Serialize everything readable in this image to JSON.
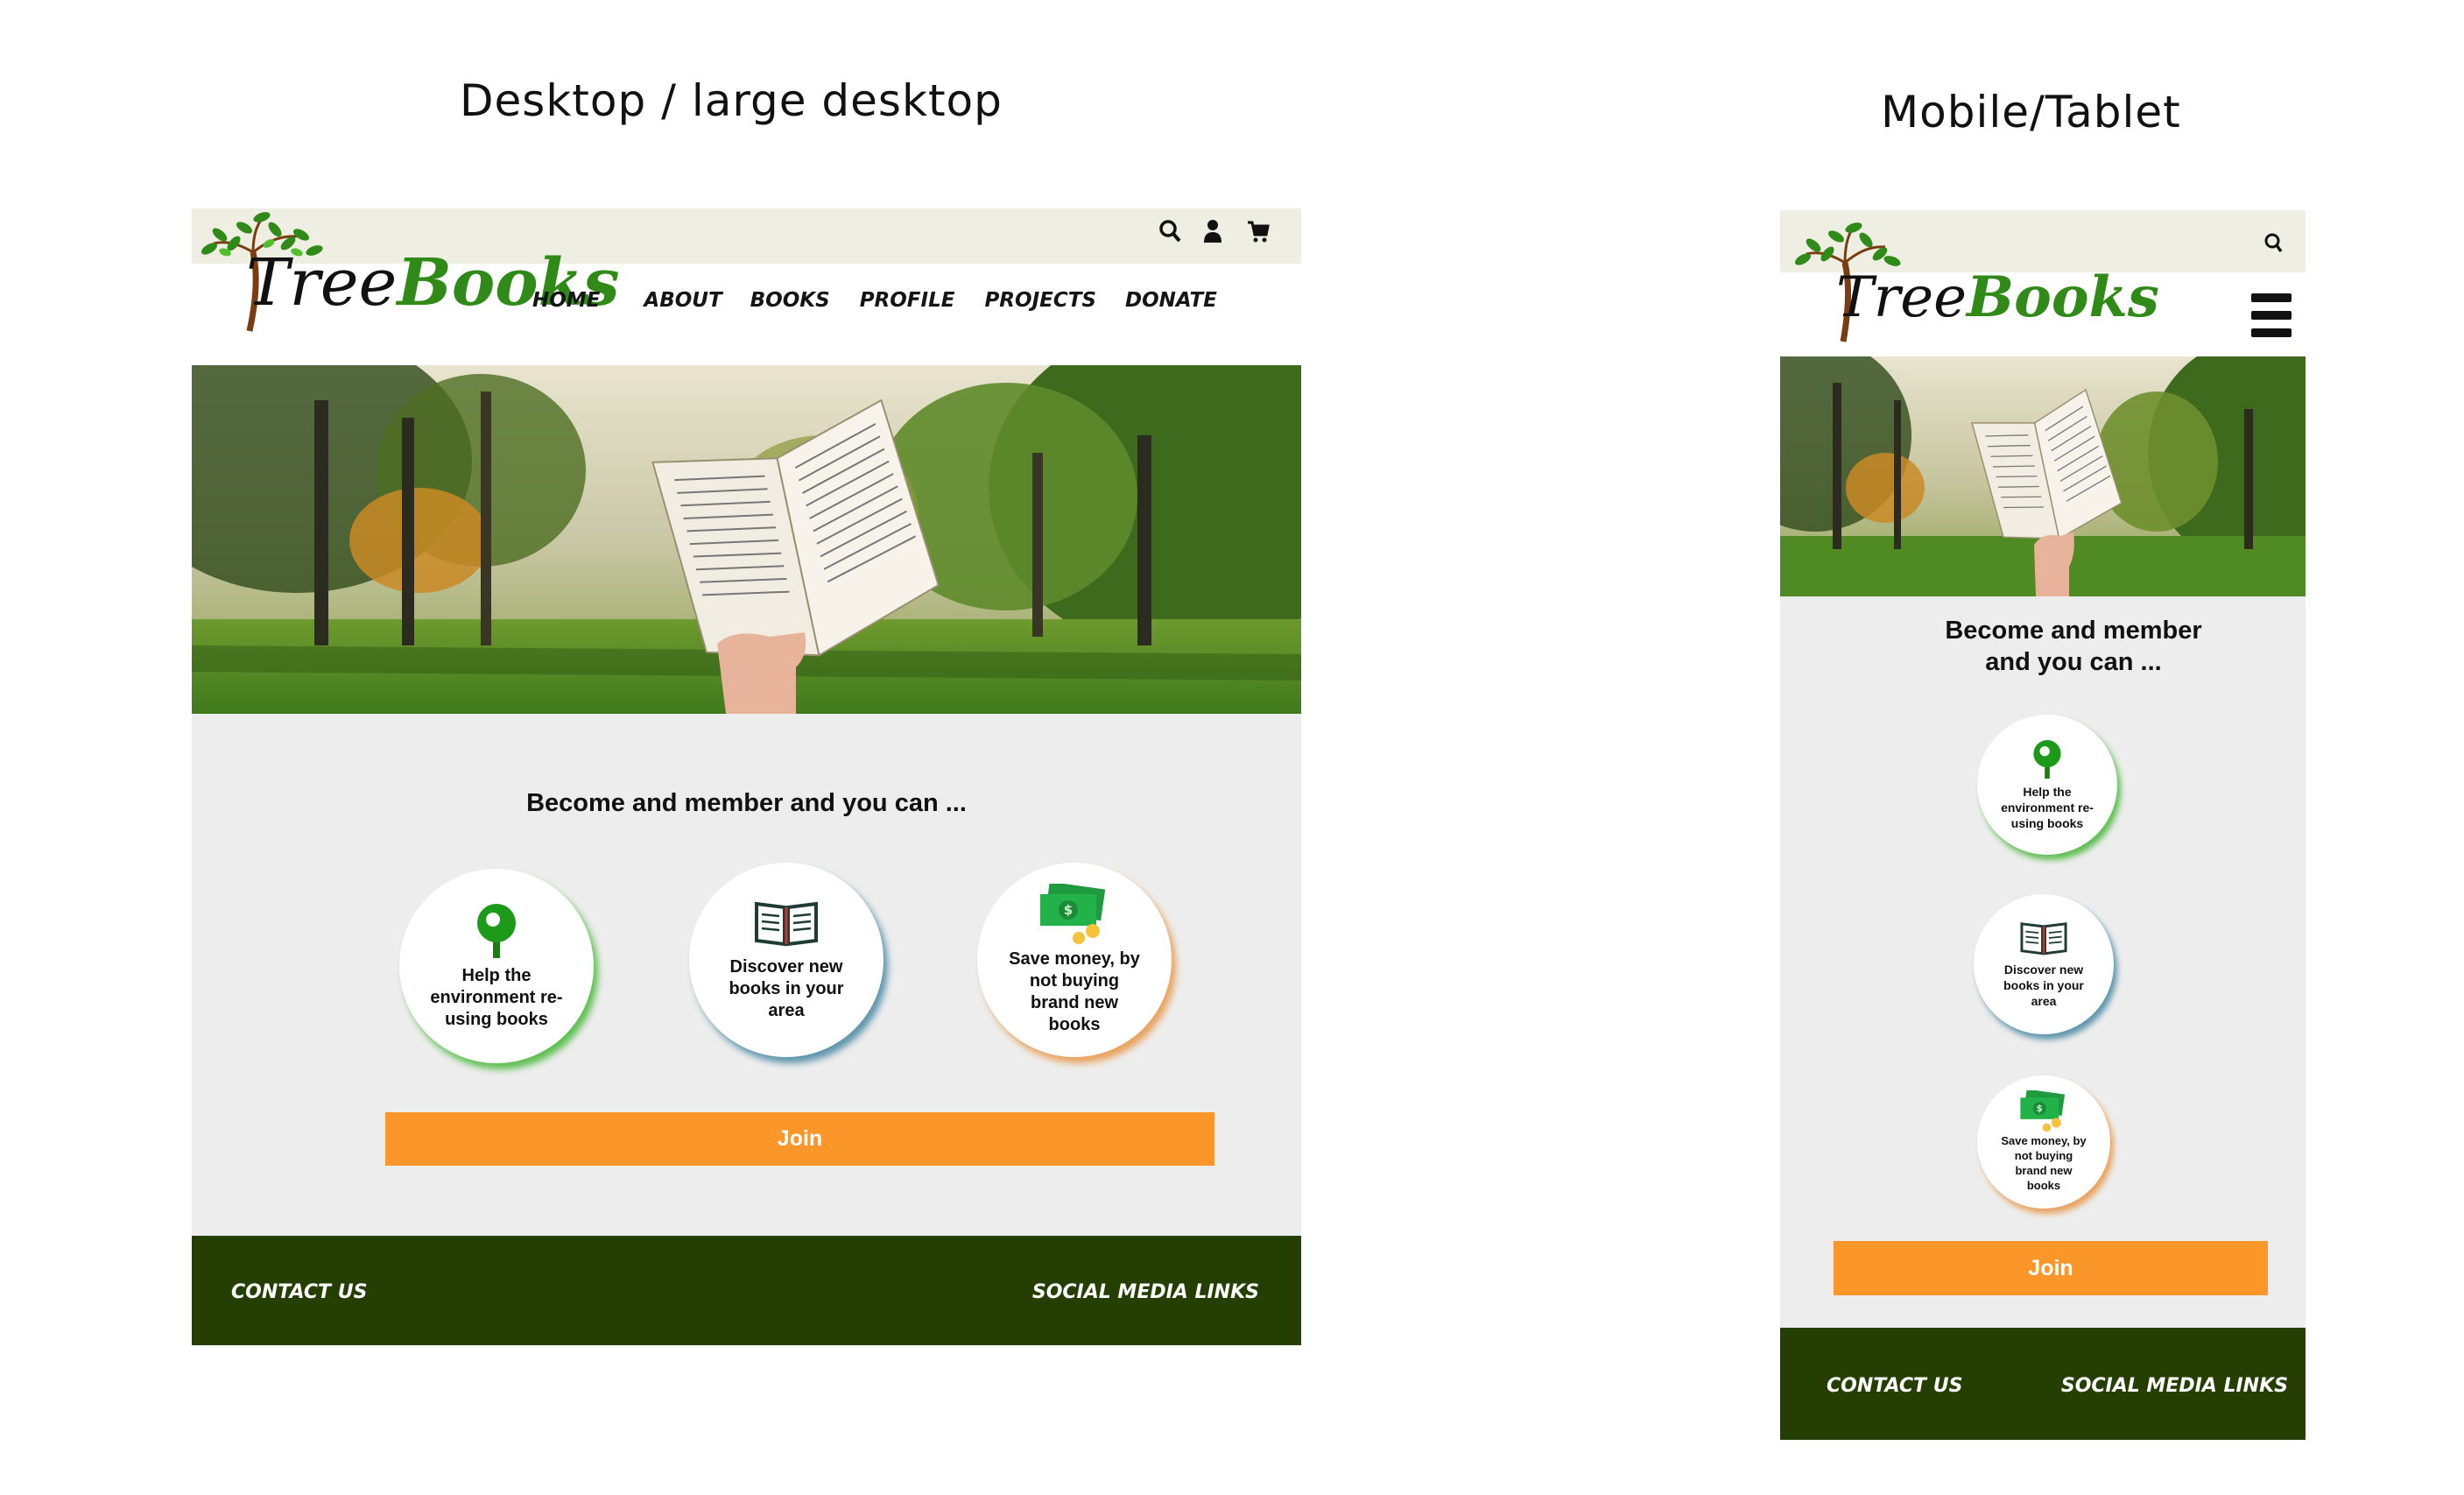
{
  "captions": {
    "desktop": "Desktop / large desktop",
    "mobile": "Mobile/Tablet"
  },
  "brand": {
    "name_first": "Tree",
    "name_second": "Books",
    "colors": {
      "topbar": "#eeeee2",
      "content_bg": "#ededed",
      "footer": "#243f01",
      "join_button": "#fb962a",
      "leaf_green": "#2f8a17"
    }
  },
  "icons": {
    "search": "search-icon",
    "account": "user-icon",
    "cart": "cart-icon",
    "menu": "hamburger-menu-icon",
    "environment": "tree-icon",
    "books": "open-book-icon",
    "money": "money-icon"
  },
  "desktop": {
    "nav": [
      "HOME",
      "ABOUT",
      "BOOKS",
      "PROFILE",
      "PROJECTS",
      "DONATE"
    ],
    "hero_alt": "Hand holding an open book in a forest",
    "headline": "Become and member and you can ...",
    "benefits": [
      {
        "text": "Help the environment re-using books",
        "icon": "tree-icon",
        "accent": "#5fbf53"
      },
      {
        "text": "Discover new books in your area",
        "icon": "open-book-icon",
        "accent": "#5f96ad"
      },
      {
        "text": "Save money, by not buying brand new books",
        "icon": "money-icon",
        "accent": "#e9a35f"
      }
    ],
    "join_label": "Join",
    "footer": {
      "contact": "CONTACT US",
      "social": "SOCIAL MEDIA LINKS"
    }
  },
  "mobile": {
    "headline": "Become and member and you can ...",
    "benefits": [
      {
        "text": "Help the environment re-using books",
        "icon": "tree-icon",
        "accent": "#5fbf53"
      },
      {
        "text": "Discover new books in your area",
        "icon": "open-book-icon",
        "accent": "#5f96ad"
      },
      {
        "text": "Save money, by not buying brand new books",
        "icon": "money-icon",
        "accent": "#e9a35f"
      }
    ],
    "join_label": "Join",
    "footer": {
      "contact": "CONTACT US",
      "social": "SOCIAL MEDIA LINKS"
    }
  }
}
